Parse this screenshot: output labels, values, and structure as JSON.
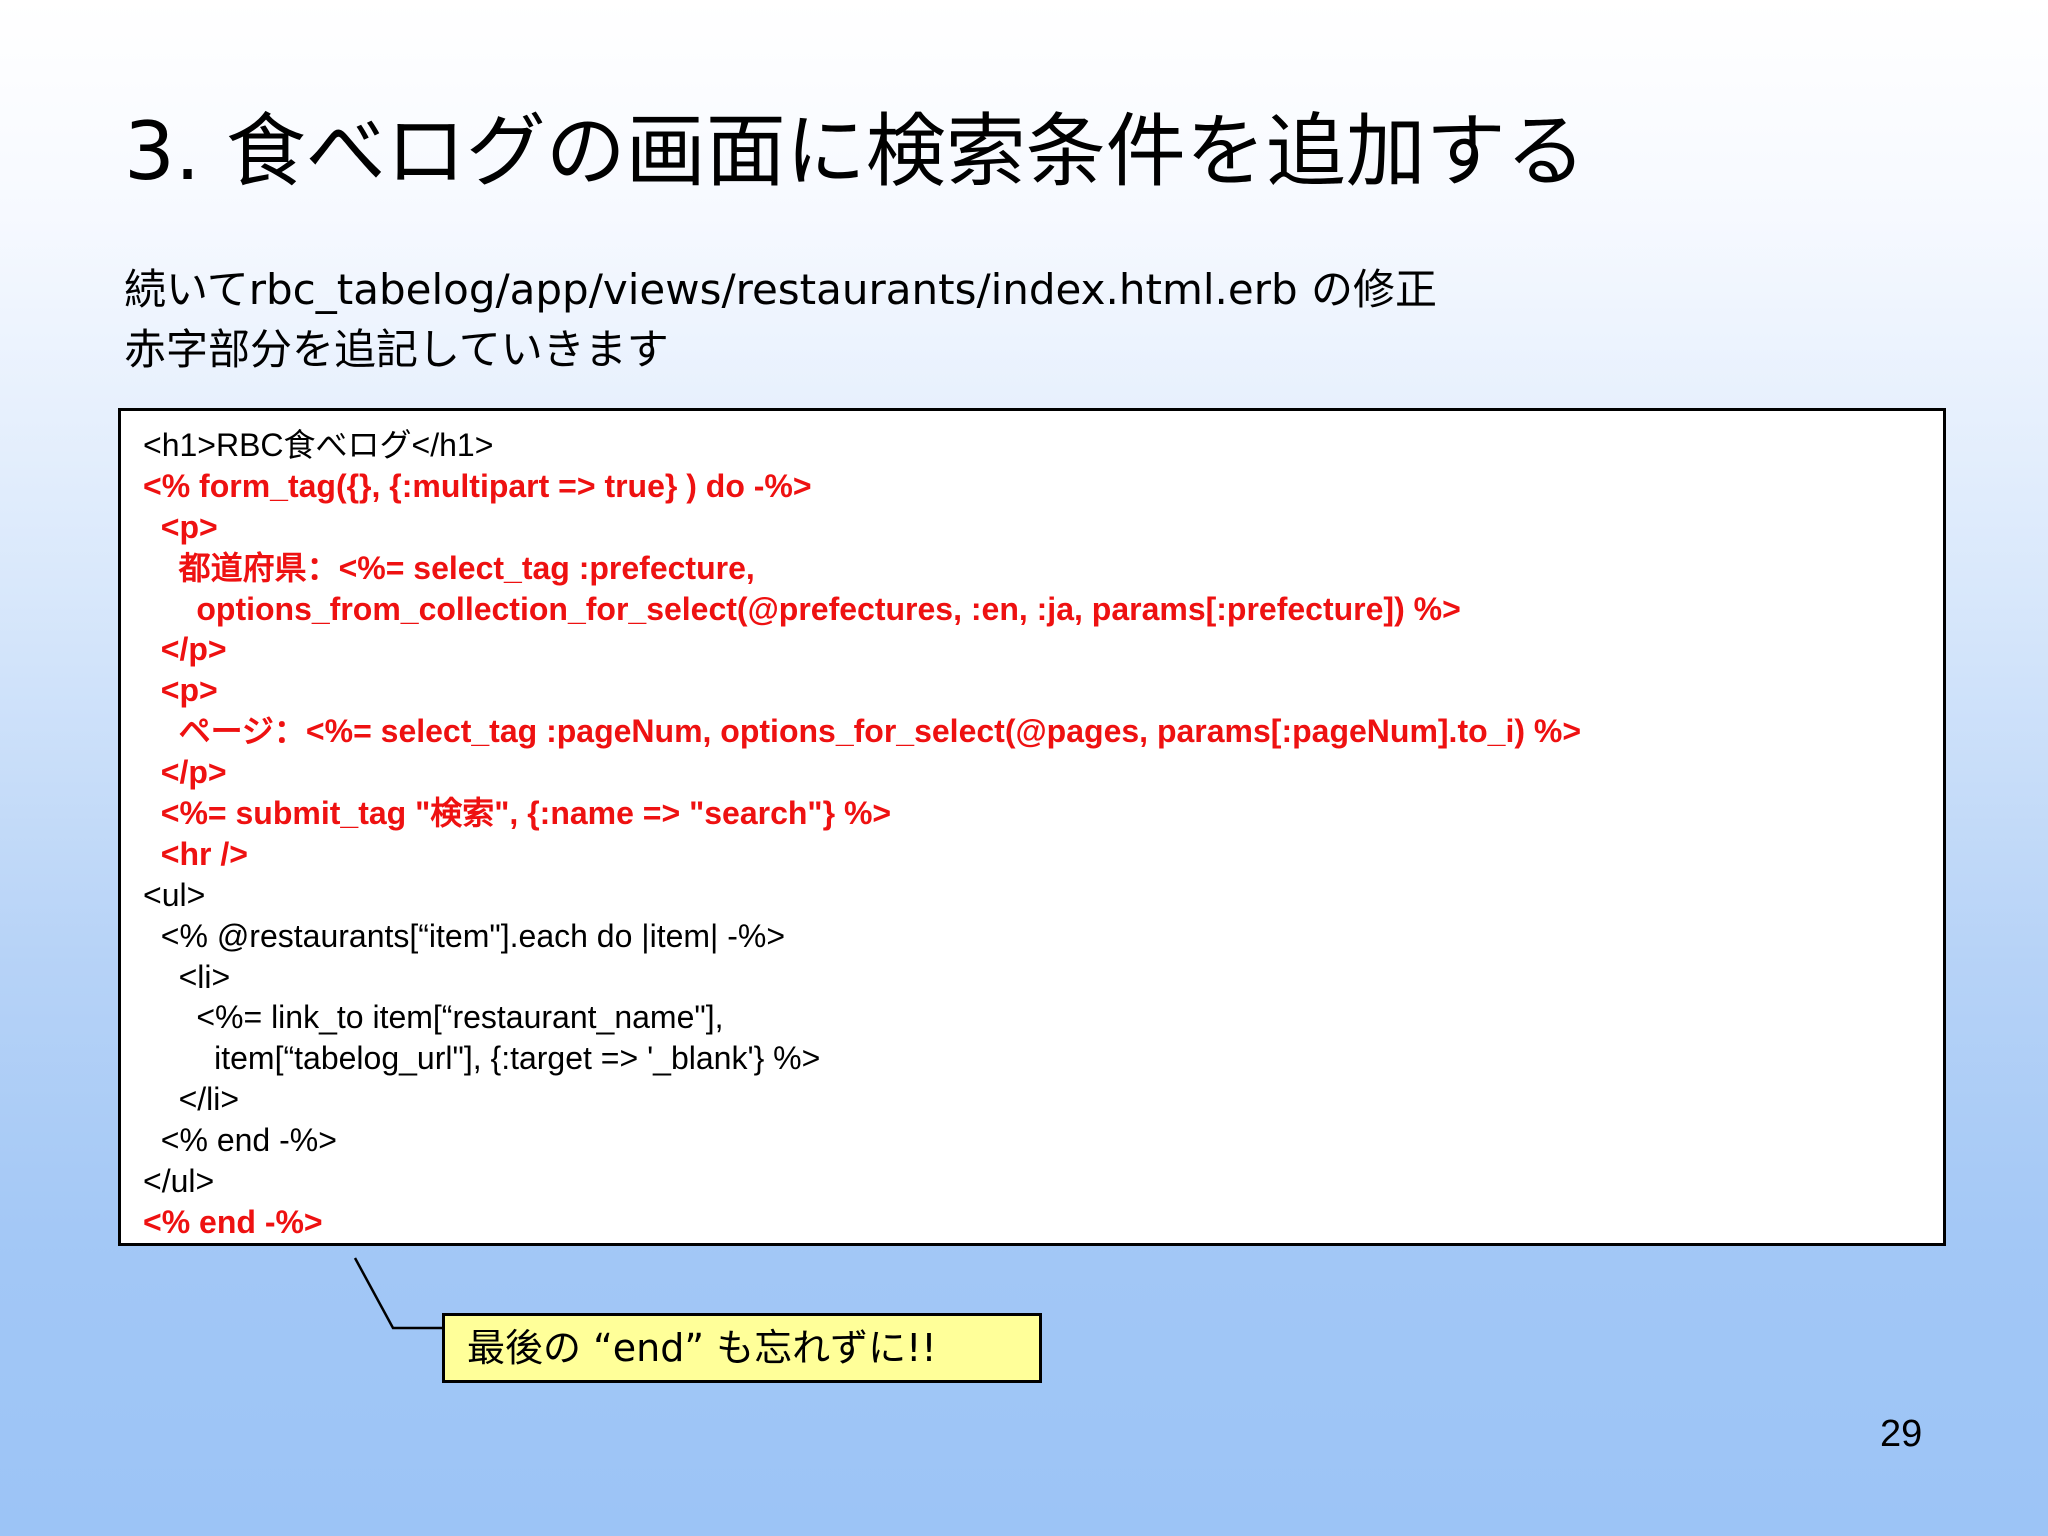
{
  "slide": {
    "title": "3. 食べログの画面に検索条件を追加する",
    "intro_lines": [
      "続いてrbc_tabelog/app/views/restaurants/index.html.erb の修正",
      "赤字部分を追記していきます"
    ],
    "page_number": "29"
  },
  "code": {
    "lines": [
      {
        "text": "<h1>RBC食べログ</h1>",
        "highlight": false
      },
      {
        "text": "<% form_tag({}, {:multipart => true} ) do -%>",
        "highlight": true
      },
      {
        "text": "  <p>",
        "highlight": true
      },
      {
        "text": "    都道府県：<%= select_tag :prefecture,",
        "highlight": true
      },
      {
        "text": "      options_from_collection_for_select(@prefectures, :en, :ja, params[:prefecture]) %>",
        "highlight": true
      },
      {
        "text": "  </p>",
        "highlight": true
      },
      {
        "text": "  <p>",
        "highlight": true
      },
      {
        "text": "    ページ：<%= select_tag :pageNum, options_for_select(@pages, params[:pageNum].to_i) %>",
        "highlight": true
      },
      {
        "text": "  </p>",
        "highlight": true
      },
      {
        "text": "  <%= submit_tag \"検索\", {:name => \"search\"} %>",
        "highlight": true
      },
      {
        "text": "  <hr />",
        "highlight": true
      },
      {
        "text": "<ul>",
        "highlight": false
      },
      {
        "text": "  <% @restaurants[“item\"].each do |item| -%>",
        "highlight": false
      },
      {
        "text": "    <li>",
        "highlight": false
      },
      {
        "text": "      <%= link_to item[“restaurant_name\"],",
        "highlight": false
      },
      {
        "text": "        item[“tabelog_url\"], {:target => '_blank'} %>",
        "highlight": false
      },
      {
        "text": "    </li>",
        "highlight": false
      },
      {
        "text": "  <% end -%>",
        "highlight": false
      },
      {
        "text": "</ul>",
        "highlight": false
      },
      {
        "text": "<% end -%>",
        "highlight": true
      }
    ],
    "highlight_color": "#ee1111"
  },
  "callout": {
    "text": "最後の “end” も忘れずに!!",
    "background": "#ffff99"
  }
}
